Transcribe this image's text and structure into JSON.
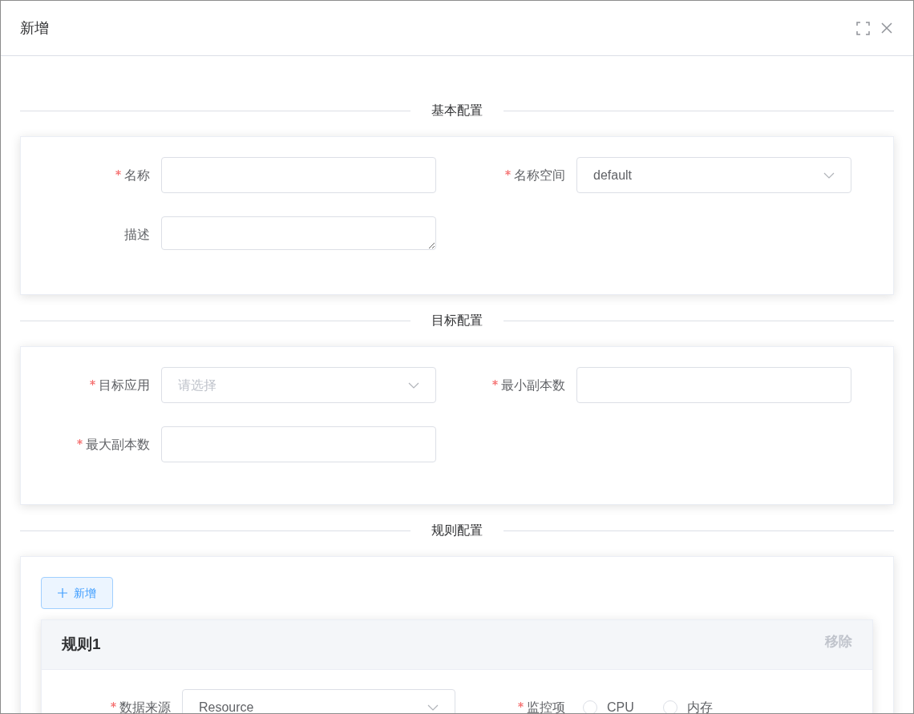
{
  "dialog": {
    "title": "新增"
  },
  "sections": [
    {
      "title": "基本配置",
      "fields": [
        {
          "kind": "input",
          "label": "名称",
          "required": true
        },
        {
          "kind": "select",
          "label": "名称空间",
          "required": true,
          "value": "default"
        },
        {
          "kind": "textarea",
          "label": "描述",
          "required": false
        }
      ]
    },
    {
      "title": "目标配置",
      "fields": [
        {
          "kind": "select",
          "label": "目标应用",
          "required": true,
          "placeholder": "请选择"
        },
        {
          "kind": "input",
          "label": "最小副本数",
          "required": true
        },
        {
          "kind": "input",
          "label": "最大副本数",
          "required": true
        }
      ]
    },
    {
      "title": "规则配置",
      "add_button": "新增",
      "rules": [
        {
          "title": "规则1",
          "remove": "移除",
          "fields": [
            {
              "kind": "select",
              "label": "数据来源",
              "required": true,
              "value": "Resource"
            },
            {
              "kind": "radio",
              "label": "监控项",
              "required": true,
              "options": [
                {
                  "label": "CPU",
                  "selected": false
                },
                {
                  "label": "内存",
                  "selected": false
                }
              ]
            }
          ]
        }
      ]
    }
  ]
}
